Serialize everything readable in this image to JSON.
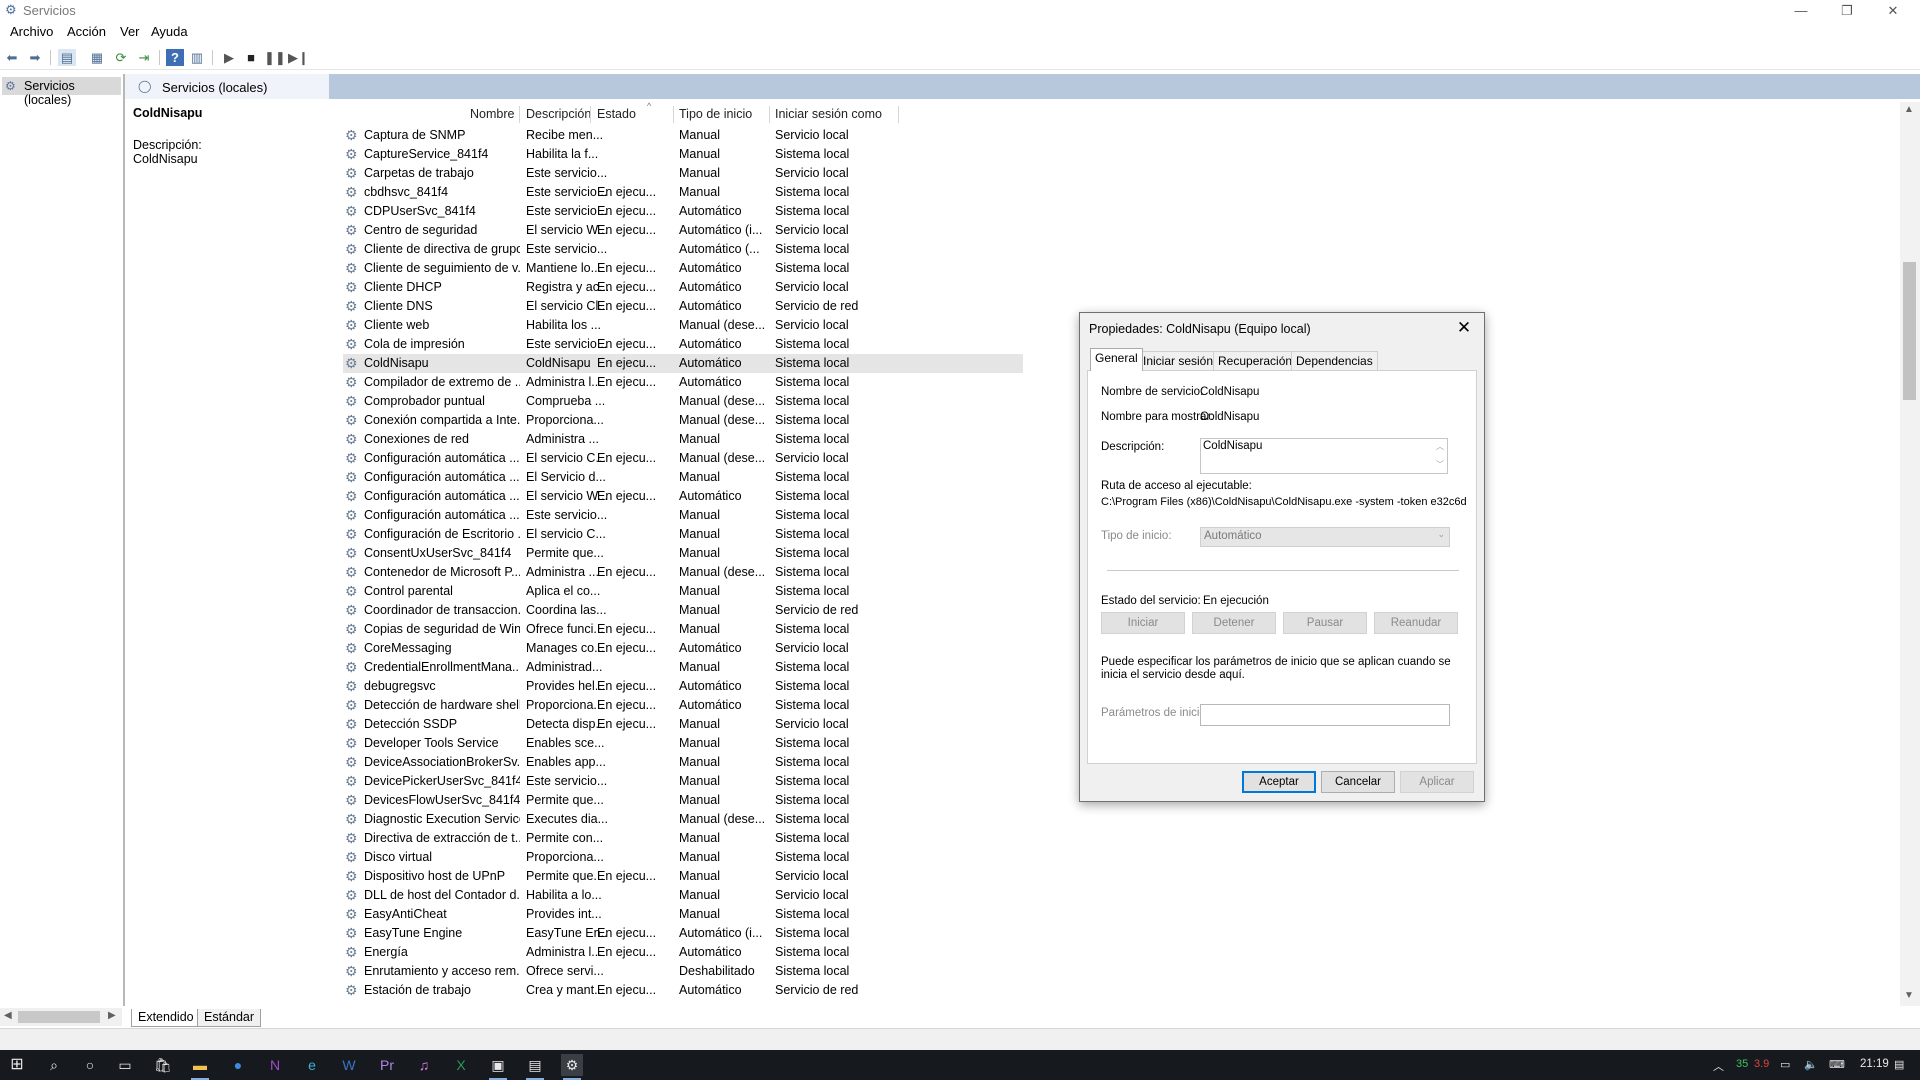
{
  "window": {
    "title": "Servicios",
    "app_icon": "gear-icon",
    "controls": [
      "minimize-icon",
      "restore-icon",
      "close-icon"
    ]
  },
  "menu": [
    "Archivo",
    "Acción",
    "Ver",
    "Ayuda"
  ],
  "toolbar": {
    "icons": [
      "back-arrow-icon",
      "forward-arrow-icon",
      "show-console-tree-icon",
      "properties-icon",
      "refresh-icon",
      "export-list-icon",
      "help-icon",
      "show-action-pane-icon",
      "start-service-icon",
      "stop-service-icon",
      "pause-service-icon",
      "restart-service-icon"
    ]
  },
  "tree": {
    "root_label": "Servicios (locales)"
  },
  "panel": {
    "header_label": "Servicios (locales)",
    "selected_service": "ColdNisapu",
    "description_label": "Descripción:",
    "description_value": "ColdNisapu"
  },
  "table": {
    "columns": [
      "Nombre",
      "Descripción",
      "Estado",
      "Tipo de inicio",
      "Iniciar sesión como"
    ],
    "rows": [
      [
        "Captura de SNMP",
        "Recibe men...",
        "",
        "Manual",
        "Servicio local"
      ],
      [
        "CaptureService_841f4",
        "Habilita la f...",
        "",
        "Manual",
        "Sistema local"
      ],
      [
        "Carpetas de trabajo",
        "Este servicio...",
        "",
        "Manual",
        "Servicio local"
      ],
      [
        "cbdhsvc_841f4",
        "Este servicio...",
        "En ejecu...",
        "Manual",
        "Sistema local"
      ],
      [
        "CDPUserSvc_841f4",
        "Este servicio...",
        "En ejecu...",
        "Automático",
        "Sistema local"
      ],
      [
        "Centro de seguridad",
        "El servicio W...",
        "En ejecu...",
        "Automático (i...",
        "Servicio local"
      ],
      [
        "Cliente de directiva de grupo",
        "Este servicio...",
        "",
        "Automático (...",
        "Sistema local"
      ],
      [
        "Cliente de seguimiento de v...",
        "Mantiene lo...",
        "En ejecu...",
        "Automático",
        "Sistema local"
      ],
      [
        "Cliente DHCP",
        "Registra y ac...",
        "En ejecu...",
        "Automático",
        "Servicio local"
      ],
      [
        "Cliente DNS",
        "El servicio Cl...",
        "En ejecu...",
        "Automático",
        "Servicio de red"
      ],
      [
        "Cliente web",
        "Habilita los ...",
        "",
        "Manual (dese...",
        "Servicio local"
      ],
      [
        "Cola de impresión",
        "Este servicio...",
        "En ejecu...",
        "Automático",
        "Sistema local"
      ],
      [
        "ColdNisapu",
        "ColdNisapu",
        "En ejecu...",
        "Automático",
        "Sistema local"
      ],
      [
        "Compilador de extremo de ...",
        "Administra l...",
        "En ejecu...",
        "Automático",
        "Sistema local"
      ],
      [
        "Comprobador puntual",
        "Comprueba ...",
        "",
        "Manual (dese...",
        "Sistema local"
      ],
      [
        "Conexión compartida a Inte...",
        "Proporciona...",
        "",
        "Manual (dese...",
        "Sistema local"
      ],
      [
        "Conexiones de red",
        "Administra ...",
        "",
        "Manual",
        "Sistema local"
      ],
      [
        "Configuración automática ...",
        "El servicio C...",
        "En ejecu...",
        "Manual (dese...",
        "Servicio local"
      ],
      [
        "Configuración automática ...",
        "El Servicio d...",
        "",
        "Manual",
        "Sistema local"
      ],
      [
        "Configuración automática ...",
        "El servicio W...",
        "En ejecu...",
        "Automático",
        "Sistema local"
      ],
      [
        "Configuración automática ...",
        "Este servicio...",
        "",
        "Manual",
        "Sistema local"
      ],
      [
        "Configuración de Escritorio ...",
        "El servicio C...",
        "",
        "Manual",
        "Sistema local"
      ],
      [
        "ConsentUxUserSvc_841f4",
        "Permite que...",
        "",
        "Manual",
        "Sistema local"
      ],
      [
        "Contenedor de Microsoft P...",
        "Administra ...",
        "En ejecu...",
        "Manual (dese...",
        "Sistema local"
      ],
      [
        "Control parental",
        "Aplica el co...",
        "",
        "Manual",
        "Sistema local"
      ],
      [
        "Coordinador de transaccion...",
        "Coordina las...",
        "",
        "Manual",
        "Servicio de red"
      ],
      [
        "Copias de seguridad de Win...",
        "Ofrece funci...",
        "En ejecu...",
        "Manual",
        "Sistema local"
      ],
      [
        "CoreMessaging",
        "Manages co...",
        "En ejecu...",
        "Automático",
        "Servicio local"
      ],
      [
        "CredentialEnrollmentMana...",
        "Administrad...",
        "",
        "Manual",
        "Sistema local"
      ],
      [
        "debugregsvc",
        "Provides hel...",
        "En ejecu...",
        "Automático",
        "Sistema local"
      ],
      [
        "Detección de hardware shell",
        "Proporciona...",
        "En ejecu...",
        "Automático",
        "Sistema local"
      ],
      [
        "Detección SSDP",
        "Detecta disp...",
        "En ejecu...",
        "Manual",
        "Servicio local"
      ],
      [
        "Developer Tools Service",
        "Enables sce...",
        "",
        "Manual",
        "Sistema local"
      ],
      [
        "DeviceAssociationBrokerSv...",
        "Enables app...",
        "",
        "Manual",
        "Sistema local"
      ],
      [
        "DevicePickerUserSvc_841f4",
        "Este servicio...",
        "",
        "Manual",
        "Sistema local"
      ],
      [
        "DevicesFlowUserSvc_841f4",
        "Permite que...",
        "",
        "Manual",
        "Sistema local"
      ],
      [
        "Diagnostic Execution Service",
        "Executes dia...",
        "",
        "Manual (dese...",
        "Sistema local"
      ],
      [
        "Directiva de extracción de t...",
        "Permite con...",
        "",
        "Manual",
        "Sistema local"
      ],
      [
        "Disco virtual",
        "Proporciona...",
        "",
        "Manual",
        "Sistema local"
      ],
      [
        "Dispositivo host de UPnP",
        "Permite que...",
        "En ejecu...",
        "Manual",
        "Servicio local"
      ],
      [
        "DLL de host del Contador d...",
        "Habilita a lo...",
        "",
        "Manual",
        "Servicio local"
      ],
      [
        "EasyAntiCheat",
        "Provides int...",
        "",
        "Manual",
        "Sistema local"
      ],
      [
        "EasyTune Engine",
        "EasyTune En...",
        "En ejecu...",
        "Automático (i...",
        "Sistema local"
      ],
      [
        "Energía",
        "Administra l...",
        "En ejecu...",
        "Automático",
        "Sistema local"
      ],
      [
        "Enrutamiento y acceso rem...",
        "Ofrece servi...",
        "",
        "Deshabilitado",
        "Sistema local"
      ],
      [
        "Estación de trabajo",
        "Crea y mant...",
        "En ejecu...",
        "Automático",
        "Servicio de red"
      ]
    ],
    "selected_index": 12
  },
  "bottom_tabs": [
    "Extendido",
    "Estándar"
  ],
  "dialog": {
    "title": "Propiedades: ColdNisapu (Equipo local)",
    "tabs": [
      "General",
      "Iniciar sesión",
      "Recuperación",
      "Dependencias"
    ],
    "service_name_label": "Nombre de servicio:",
    "service_name_value": "ColdNisapu",
    "display_name_label": "Nombre para mostrar:",
    "display_name_value": "ColdNisapu",
    "description_label": "Descripción:",
    "description_value": "ColdNisapu",
    "exe_path_label": "Ruta de acceso al ejecutable:",
    "exe_path_value": "C:\\Program Files (x86)\\ColdNisapu\\ColdNisapu.exe -system -token e32c6d",
    "startup_type_label": "Tipo de inicio:",
    "startup_type_value": "Automático",
    "service_status_label": "Estado del servicio:",
    "service_status_value": "En ejecución",
    "buttons_service": [
      "Iniciar",
      "Detener",
      "Pausar",
      "Reanudar"
    ],
    "start_params_hint": "Puede especificar los parámetros de inicio que se aplican cuando se inicia el servicio desde aquí.",
    "start_params_label": "Parámetros de inicio:",
    "start_params_value": "",
    "ok_label": "Aceptar",
    "cancel_label": "Cancelar",
    "apply_label": "Aplicar"
  },
  "taskbar": {
    "icons": [
      "start-icon",
      "search-icon",
      "cortana-icon",
      "task-view-icon",
      "store-icon",
      "file-explorer-icon",
      "app-blue-circle-icon",
      "onenote-icon",
      "edge-icon",
      "word-icon",
      "premiere-icon",
      "itunes-icon",
      "excel-icon",
      "remote-desktop-icon",
      "network-app-icon",
      "services-app-icon"
    ],
    "tray": {
      "cpu_text": "35",
      "temp_text": "3.9",
      "time": "21:19"
    }
  }
}
